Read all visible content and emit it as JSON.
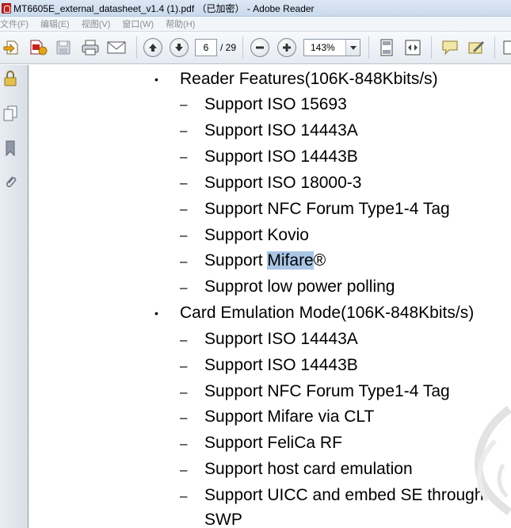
{
  "window": {
    "title": "MT6605E_external_datasheet_v1.4 (1).pdf （已加密） - Adobe Reader"
  },
  "menu": {
    "items": [
      "文件(F)",
      "编辑(E)",
      "视图(V)",
      "窗口(W)",
      "帮助(H)"
    ]
  },
  "toolbar": {
    "page_current": "6",
    "page_total": "/ 29",
    "zoom": "143%"
  },
  "icons": {
    "create_pdf": "create-pdf-icon",
    "export": "export-icon",
    "save": "save-icon",
    "print": "print-icon",
    "email": "email-icon",
    "prev_page": "arrow-up-icon",
    "next_page": "arrow-down-icon",
    "zoom_out": "minus-icon",
    "zoom_in": "plus-icon",
    "fit_page": "fit-page-icon",
    "fit_width": "fit-width-icon",
    "comment": "comment-icon",
    "sign": "sign-icon",
    "side_lock": "lock-icon",
    "side_pages": "pages-icon",
    "side_bookmarks": "bookmark-icon",
    "side_attachments": "paperclip-icon"
  },
  "document": {
    "sections": [
      {
        "heading": "Reader Features(106K-848Kbits/s)",
        "items": [
          "Support ISO 15693",
          "Support ISO 14443A",
          "Support ISO 14443B",
          "Support ISO 18000-3",
          "Support NFC Forum Type1-4 Tag",
          "Support Kovio",
          "Support Mifare®",
          "Supprot low power polling"
        ]
      },
      {
        "heading": "Card Emulation Mode(106K-848Kbits/s)",
        "items": [
          "Support ISO 14443A",
          "Support ISO 14443B",
          "Support NFC Forum Type1-4 Tag",
          "Support Mifare via CLT",
          "Support FeliCa RF",
          "Support host card emulation",
          "Support UICC and embed SE through",
          "SWP"
        ]
      }
    ],
    "highlight": {
      "prefix": "Support ",
      "word": "Mifare",
      "suffix": "®"
    },
    "bullet_glyph": "•",
    "dash_glyph": "–"
  },
  "colors": {
    "selection": "#a9c6e6",
    "panel": "#e1e6ec"
  }
}
